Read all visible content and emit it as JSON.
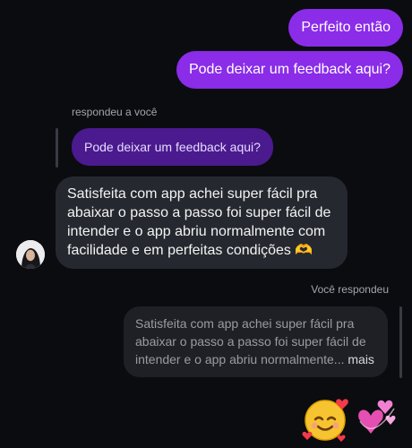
{
  "messages": {
    "sent_1": "Perfeito então",
    "sent_2": "Pode deixar um feedback aqui?",
    "replied_caption": "respondeu a você",
    "quoted_sent": "Pode deixar um feedback aqui?",
    "received": "Satisfeita com app achei super fácil pra abaixar o passo a passo foi super fácil de intender e o app abriu normalmente com facilidade e em perfeitas condições 🫶",
    "you_replied_caption": "Você respondeu",
    "quoted_received": "Satisfeita com app achei super fácil pra abaixar o passo a passo foi super fácil de intender e o app abriu normalmente...",
    "more_label": "mais"
  },
  "reactions": [
    {
      "icon": "smiling-face-with-hearts-icon"
    },
    {
      "icon": "revolving-hearts-icon"
    }
  ],
  "colors": {
    "background": "#0b0c10",
    "sent_bubble": "#8a2ce8",
    "received_bubble": "#262830"
  }
}
